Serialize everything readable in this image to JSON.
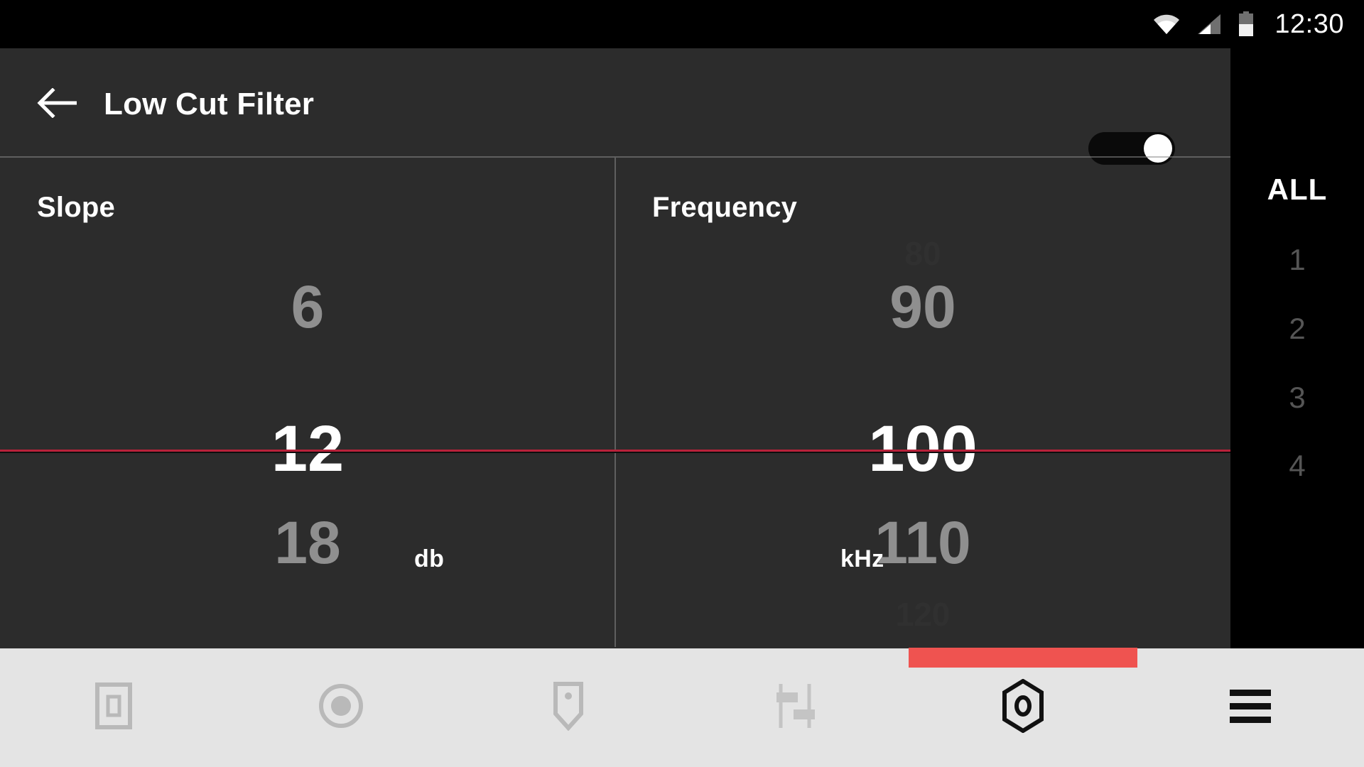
{
  "statusbar": {
    "time": "12:30",
    "icons": [
      "wifi-icon",
      "cellular-signal-icon",
      "battery-icon"
    ]
  },
  "appbar": {
    "title": "Low Cut Filter",
    "back_icon": "back-arrow-icon",
    "power_toggle": {
      "name": "power-toggle",
      "state": "on",
      "track_color": "#0a0a0a",
      "knob_color": "#ffffff"
    }
  },
  "wheels": [
    {
      "label": "Slope",
      "unit": "db",
      "ghost_top": "",
      "above_far": "",
      "above": "6",
      "selected": "12",
      "below": "18",
      "ghost_bottom": ""
    },
    {
      "label": "Frequency",
      "unit": "kHz",
      "ghost_top": "80",
      "above_far": "",
      "above": "90",
      "selected": "100",
      "below": "110",
      "ghost_bottom": "120"
    }
  ],
  "selection_line_color": "#b9223a",
  "rail": {
    "items": [
      {
        "label": "ALL",
        "active": true
      },
      {
        "label": "1",
        "active": false
      },
      {
        "label": "2",
        "active": false
      },
      {
        "label": "3",
        "active": false
      },
      {
        "label": "4",
        "active": false
      }
    ]
  },
  "bottomnav": {
    "indicator_color": "#ef5350",
    "items": [
      {
        "icon": "screen-frame-icon",
        "active": false
      },
      {
        "icon": "record-circle-icon",
        "active": false
      },
      {
        "icon": "tag-marker-icon",
        "active": false
      },
      {
        "icon": "faders-icon",
        "active": false
      },
      {
        "icon": "hex-settings-icon",
        "active": true
      },
      {
        "icon": "hamburger-menu-icon",
        "active": false
      }
    ]
  }
}
